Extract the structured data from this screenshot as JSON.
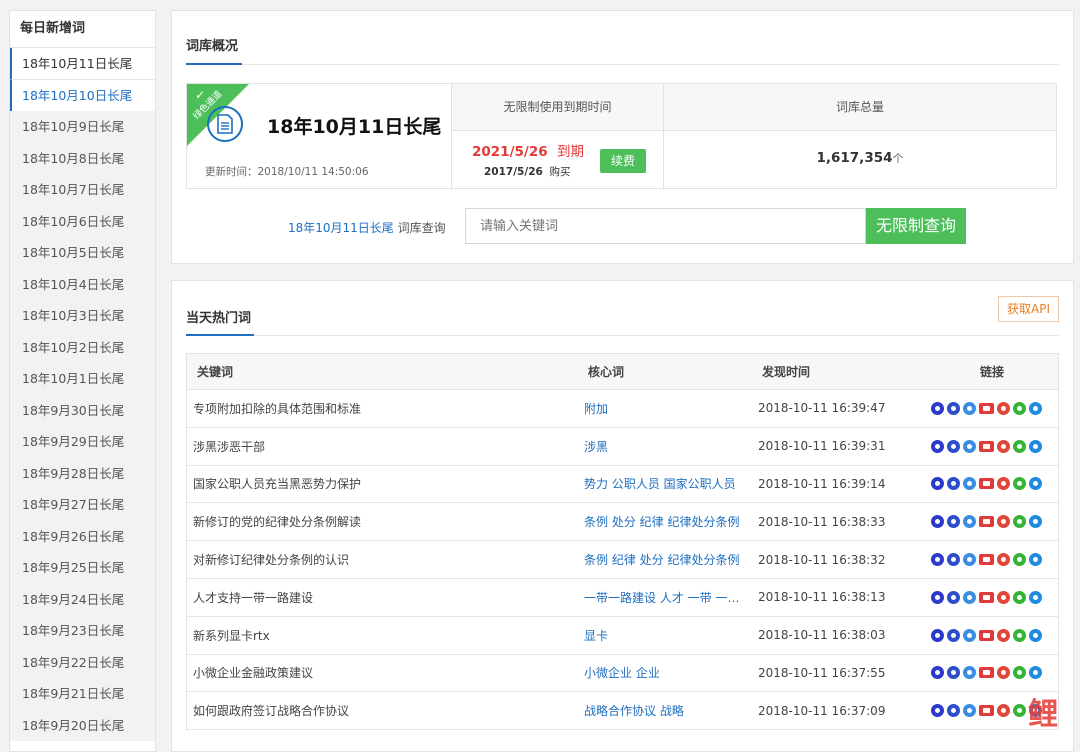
{
  "sidebar": {
    "title": "每日新增词",
    "items": [
      "18年10月11日长尾",
      "18年10月10日长尾",
      "18年10月9日长尾",
      "18年10月8日长尾",
      "18年10月7日长尾",
      "18年10月6日长尾",
      "18年10月5日长尾",
      "18年10月4日长尾",
      "18年10月3日长尾",
      "18年10月2日长尾",
      "18年10月1日长尾",
      "18年9月30日长尾",
      "18年9月29日长尾",
      "18年9月28日长尾",
      "18年9月27日长尾",
      "18年9月26日长尾",
      "18年9月25日长尾",
      "18年9月24日长尾",
      "18年9月23日长尾",
      "18年9月22日长尾",
      "18年9月21日长尾",
      "18年9月20日长尾"
    ]
  },
  "overview": {
    "title": "词库概况",
    "ribbon": "绿色通道",
    "name": "18年10月11日长尾",
    "updated": "更新时间：2018/10/11 14:50:06",
    "expire_header": "无限制使用到期时间",
    "expire_date": "2021/5/26",
    "expire_suffix": "到期",
    "buy_date": "2017/5/26",
    "buy_suffix": "购买",
    "renew": "续费",
    "total_header": "词库总量",
    "total_value": "1,617,354",
    "total_unit": "个"
  },
  "search": {
    "lib_link": "18年10月11日长尾",
    "lib_suffix": "词库查询",
    "placeholder": "请输入关键词",
    "button": "无限制查询"
  },
  "hot": {
    "title": "当天热门词",
    "api_button": "获取API",
    "columns": [
      "关键词",
      "核心词",
      "发现时间",
      "链接"
    ],
    "rows": [
      {
        "kw": "专项附加扣除的具体范围和标准",
        "core": "附加",
        "time": "2018-10-11 16:39:47"
      },
      {
        "kw": "涉黑涉恶干部",
        "core": "涉黑",
        "time": "2018-10-11 16:39:31"
      },
      {
        "kw": "国家公职人员充当黑恶势力保护",
        "core": "势力 公职人员 国家公职人员",
        "time": "2018-10-11 16:39:14"
      },
      {
        "kw": "新修订的党的纪律处分条例解读",
        "core": "条例 处分 纪律 纪律处分条例",
        "time": "2018-10-11 16:38:33"
      },
      {
        "kw": "对新修订纪律处分条例的认识",
        "core": "条例 纪律 处分 纪律处分条例",
        "time": "2018-10-11 16:38:32"
      },
      {
        "kw": "人才支持一带一路建设",
        "core": "一带一路建设 人才 一带 一…",
        "time": "2018-10-11 16:38:13"
      },
      {
        "kw": "新系列显卡rtx",
        "core": "显卡",
        "time": "2018-10-11 16:38:03"
      },
      {
        "kw": "小微企业金融政策建议",
        "core": "小微企业 企业",
        "time": "2018-10-11 16:37:55"
      },
      {
        "kw": "如何跟政府签订战略合作协议",
        "core": "战略合作协议 战略",
        "time": "2018-10-11 16:37:09"
      }
    ]
  },
  "link_icons": [
    "baidu-icon",
    "doc-icon",
    "360-icon",
    "toutiao-icon",
    "weibo-icon",
    "wechat-icon",
    "zhihu-icon"
  ],
  "watermark": "鲤"
}
